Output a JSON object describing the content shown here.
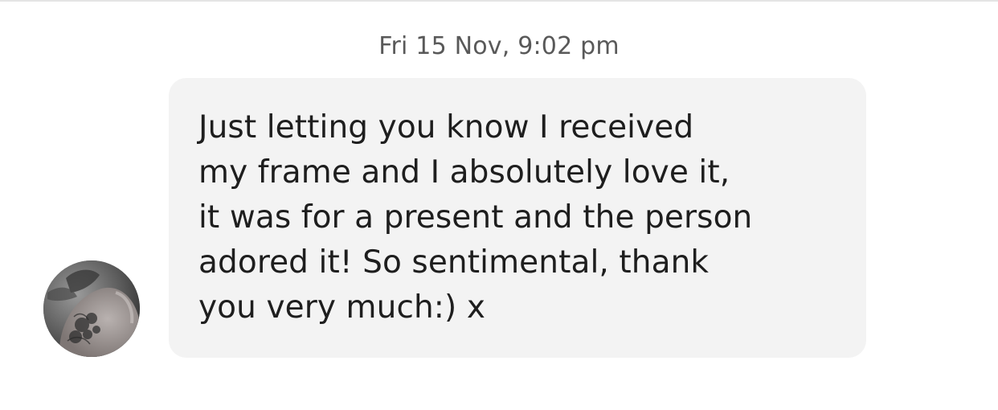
{
  "conversation": {
    "timestamp": "Fri 15 Nov, 9:02 pm",
    "message": {
      "lines": [
        "Just letting you know I received",
        "my frame and I absolutely love it,",
        "it was for a present and the person",
        "adored it! So sentimental, thank",
        "you very much:) x"
      ]
    }
  }
}
